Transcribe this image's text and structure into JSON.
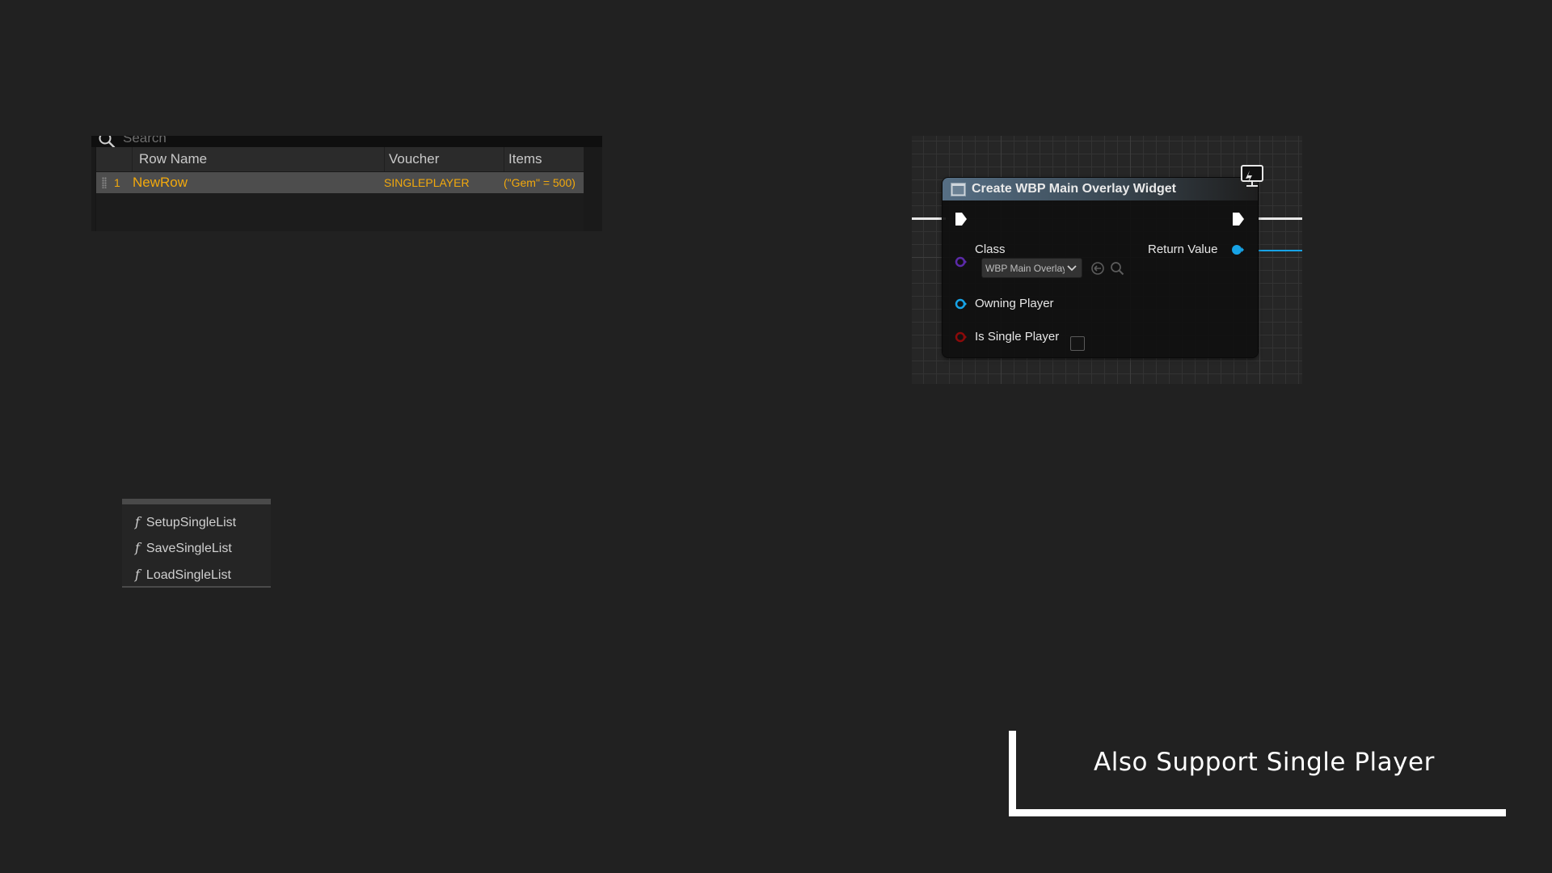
{
  "data_table": {
    "search": {
      "placeholder": "Search"
    },
    "columns": [
      "Row Name",
      "Voucher",
      "Items"
    ],
    "rows": [
      {
        "index": "1",
        "row_name": "NewRow",
        "voucher": "SINGLEPLAYER",
        "items": "(\"Gem\" = 500)"
      }
    ]
  },
  "blueprint_node": {
    "title": "Create WBP Main Overlay Widget",
    "pins": {
      "class_label": "Class",
      "class_value": "WBP Main Overlay",
      "return_value": "Return Value",
      "owning_player": "Owning Player",
      "is_single_player": "Is Single Player",
      "is_single_player_checked": false
    },
    "colors": {
      "exec": "#ffffff",
      "class_pin": "#5b2aa8",
      "object_pin": "#17a3e6",
      "bool_pin": "#8b0a0a"
    }
  },
  "function_list": {
    "items": [
      "SetupSingleList",
      "SaveSingleList",
      "LoadSingleList"
    ],
    "icon": "function-icon"
  },
  "caption": {
    "text": "Also Support Single Player"
  }
}
